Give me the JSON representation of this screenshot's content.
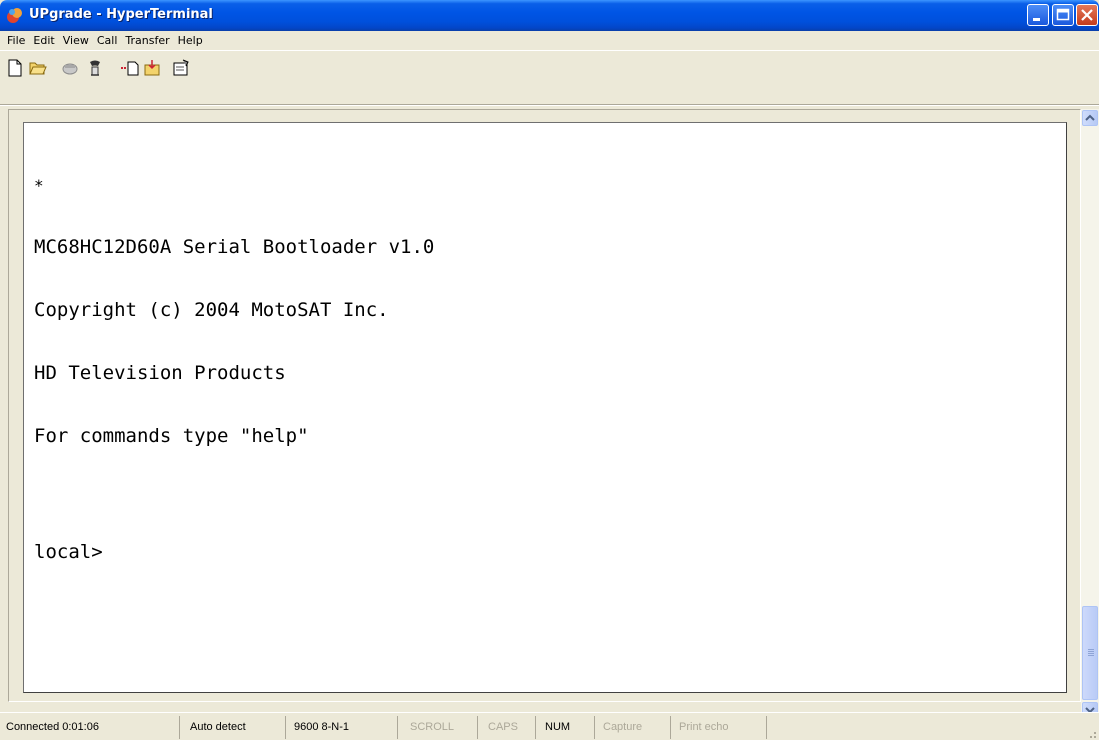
{
  "window": {
    "title": "UPgrade - HyperTerminal"
  },
  "menu": {
    "items": [
      "File",
      "Edit",
      "View",
      "Call",
      "Transfer",
      "Help"
    ]
  },
  "toolbar": {
    "icons": [
      "new-icon",
      "open-icon",
      "disconnect-icon",
      "connect-icon",
      "send-icon",
      "receive-icon",
      "properties-icon"
    ]
  },
  "terminal": {
    "lines": [
      "*",
      "MC68HC12D60A Serial Bootloader v1.0",
      "Copyright (c) 2004 MotoSAT Inc.",
      "HD Television Products",
      "For commands type \"help\"",
      "local>"
    ]
  },
  "status": {
    "connected": "Connected 0:01:06",
    "detect": "Auto detect",
    "settings": "9600 8-N-1",
    "scroll": "SCROLL",
    "caps": "CAPS",
    "num": "NUM",
    "capture": "Capture",
    "print_echo": "Print echo"
  },
  "colors": {
    "titlebar": "#0055e5",
    "window_bg": "#ece9d8",
    "terminal_bg": "#ffffff",
    "close_button": "#c43b1c"
  }
}
